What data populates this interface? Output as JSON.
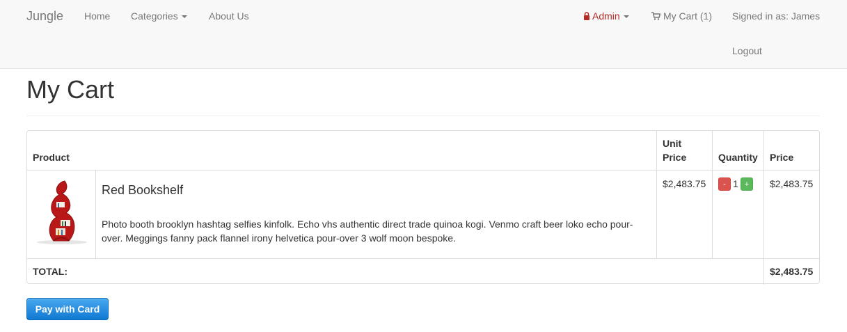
{
  "nav": {
    "brand": "Jungle",
    "home": "Home",
    "categories": "Categories",
    "about": "About Us",
    "admin": "Admin",
    "cart": "My Cart (1)",
    "signed_in": "Signed in as: James",
    "logout": "Logout"
  },
  "page": {
    "title": "My Cart"
  },
  "table": {
    "headers": {
      "product": "Product",
      "unit_price": "Unit Price",
      "quantity": "Quantity",
      "price": "Price"
    },
    "items": [
      {
        "name": "Red Bookshelf",
        "description": "Photo booth brooklyn hashtag selfies kinfolk. Echo vhs authentic direct trade quinoa kogi. Venmo craft beer loko echo pour-over. Meggings fanny pack flannel irony helvetica pour-over 3 wolf moon bespoke.",
        "unit_price": "$2,483.75",
        "quantity": "1",
        "price": "$2,483.75",
        "minus": "-",
        "plus": "+"
      }
    ],
    "total_label": "TOTAL:",
    "total_value": "$2,483.75"
  },
  "pay_button": "Pay with Card",
  "colors": {
    "admin": "#b52a27",
    "pay": "#1a83dd",
    "minus": "#d9534f",
    "plus": "#5cb85c"
  },
  "icons": [
    "lock-icon",
    "cart-icon",
    "chevron-down-icon"
  ]
}
